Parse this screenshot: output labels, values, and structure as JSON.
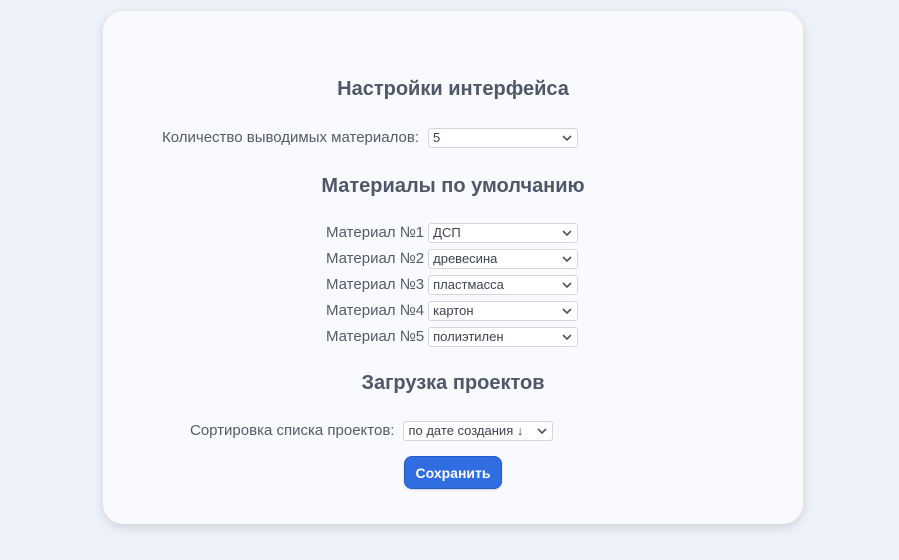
{
  "interface_settings": {
    "title": "Настройки интерфейса",
    "count_label": "Количество выводимых материалов:",
    "count_value": "5"
  },
  "default_materials": {
    "title": "Материалы по умолчанию",
    "items": [
      {
        "label": "Материал №1",
        "value": "ДСП"
      },
      {
        "label": "Материал №2",
        "value": "древесина"
      },
      {
        "label": "Материал №3",
        "value": "пластмасса"
      },
      {
        "label": "Материал №4",
        "value": "картон"
      },
      {
        "label": "Материал №5",
        "value": "полиэтилен"
      }
    ]
  },
  "project_loading": {
    "title": "Загрузка проектов",
    "sort_label": "Сортировка списка проектов:",
    "sort_value": "по дате создания ↓"
  },
  "save_button_label": "Сохранить",
  "colors": {
    "page_background": "#edf1f8",
    "card_background": "#f8fafd",
    "accent": "#2f6de1"
  }
}
